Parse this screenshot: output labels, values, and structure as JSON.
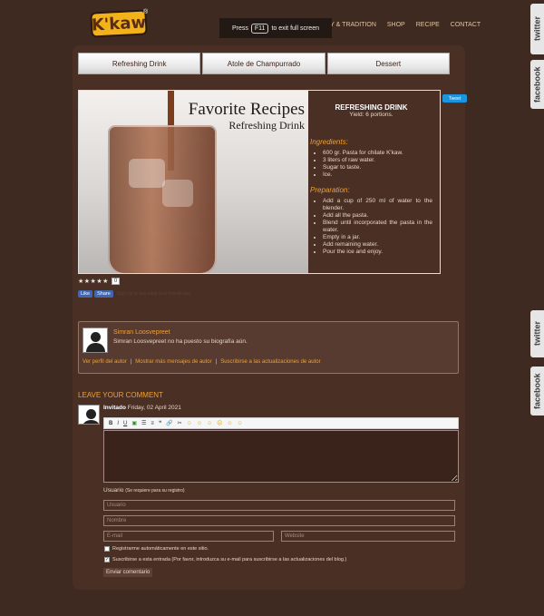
{
  "header": {
    "logo": "K'kaw",
    "logo_mark": "®",
    "fullscreen_pre": "Press",
    "fullscreen_key": "F11",
    "fullscreen_post": "to exit full screen",
    "nav": [
      "HISTORY & TRADITION",
      "SHOP",
      "RECIPE",
      "CONTACT"
    ]
  },
  "tabs": [
    "Refreshing Drink",
    "Atole de Champurrado",
    "Dessert"
  ],
  "recipe": {
    "image_title": "Favorite Recipes",
    "image_subtitle": "Refreshing Drink",
    "title": "REFRESHING DRINK",
    "yield": "Yield: 6 portions.",
    "ingredients_heading": "Ingredients:",
    "ingredients": [
      "600 gr. Pasta for chilate K'kaw.",
      "3 liters of raw water.",
      "Sugar to taste.",
      "Ice."
    ],
    "preparation_heading": "Preparation:",
    "preparation": [
      "Add a cup of 250 ml of water to the blender.",
      "Add all the pasta.",
      "Blend until incorporated the pasta in the water.",
      "Empty in a jar.",
      "Add remaining water.",
      "Pour the ice and enjoy."
    ]
  },
  "social": {
    "tweet": "Tweet",
    "stars": "★★★★★",
    "rating_count": "0",
    "like": "Like",
    "share": "Share",
    "fb_text": "Sign Up to see what your friends like.",
    "side_twitter": "twitter",
    "side_facebook": "facebook"
  },
  "author": {
    "name": "Simran Loosvepreet",
    "bio": "Simran Loosvepreet no ha puesto su biografía aún.",
    "links": [
      "Ver perfil del autor",
      "Mostrar más mensajes de autor",
      "Suscribirse a las actualizaciones de autor"
    ]
  },
  "comment": {
    "heading": "LEAVE YOUR COMMENT",
    "user": "Invitado",
    "date": "Friday, 02 April 2021",
    "usuario_label": "Usuario",
    "usuario_note": "(Se requiere para su registro)",
    "placeholder_user": "Usuario",
    "placeholder_name": "Nombre",
    "placeholder_email": "E-mail",
    "placeholder_web": "Website",
    "register_label": "Registrarme automáticamente en este sitio.",
    "subscribe_label": "Suscribirse a esta entrada (Por favor, introduzca su e-mail para suscribirse a las actualizaciones del blog.)",
    "submit": "Enviar comentario"
  }
}
